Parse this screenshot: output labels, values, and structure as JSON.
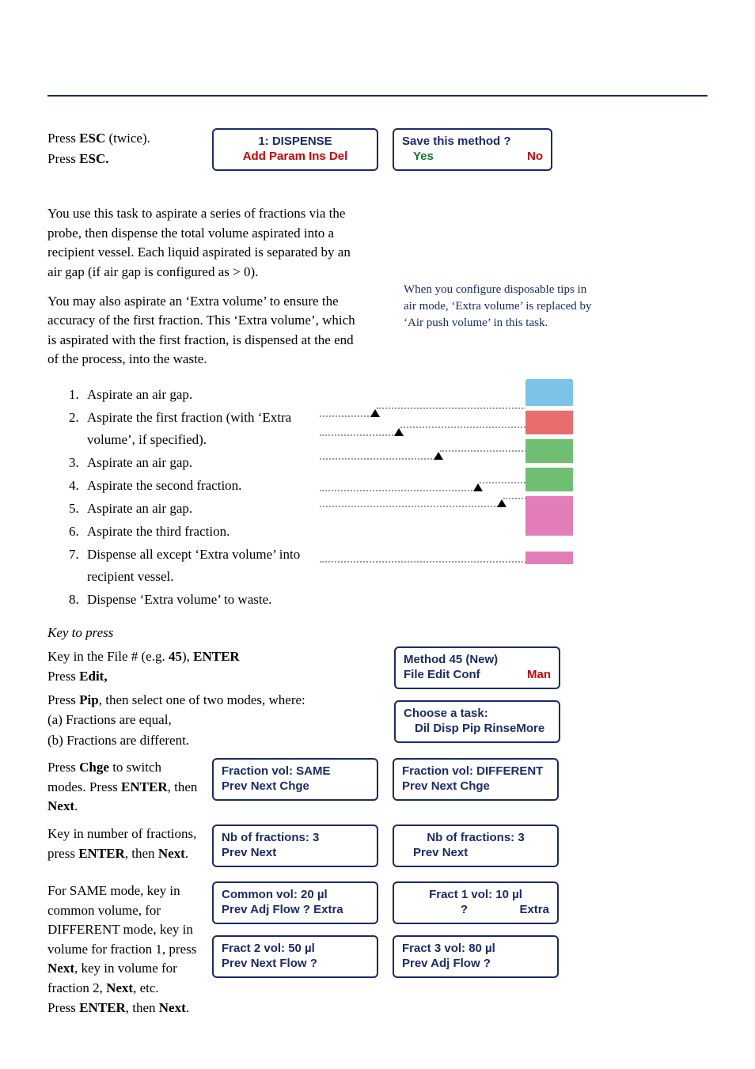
{
  "header": {
    "esc_twice": "Press ESC (twice).",
    "esc_once": "Press ESC.",
    "lcd_dispense_l1": "1: DISPENSE",
    "lcd_dispense_l2": "Add Param Ins  Del",
    "lcd_save_q": "Save this method ?",
    "lcd_save_yes": "Yes",
    "lcd_save_no": "No"
  },
  "intro": {
    "p1": "You use this task to aspirate a series of fractions via the probe, then dispense the total volume aspirated into a recipient vessel. Each liquid aspirated is separated by an air gap (if air gap is configured as > 0).",
    "p2": "You may also aspirate an ‘Extra volume’ to ensure the accuracy of the first fraction. This ‘Extra volume’, which is aspirated with the first fraction, is dispensed at the end of the process, into the waste.",
    "aside": "When you configure disposable tips in air mode, ‘Extra volume’ is replaced by ‘Air push volume’ in this task."
  },
  "steps": {
    "s1": "Aspirate an air gap.",
    "s2": "Aspirate the first fraction (with ‘Extra volume’, if specified).",
    "s3": "Aspirate an air gap.",
    "s4": "Aspirate the second fraction.",
    "s5": "Aspirate an air gap.",
    "s6": "Aspirate the third fraction.",
    "s7": "Dispense all except ‘Extra volume’ into recipient vessel.",
    "s8": "Dispense ‘Extra volume’ to waste."
  },
  "keys": {
    "heading": "Key to press",
    "file_enter": "Key in the File # (e.g. 45), ENTER",
    "press_edit": "Press Edit,",
    "press_pip": "Press Pip, then select one of two modes, where:",
    "mode_a": "(a) Fractions are equal,",
    "mode_b": "(b) Fractions are different.",
    "chge": "Press Chge to switch modes. Press ENTER, then Next.",
    "nfrac": "Key in number of fractions,",
    "enter_next": "press ENTER, then Next.",
    "same_diff": "For SAME mode, key in common volume, for DIFFERENT mode, key in volume for fraction 1, press Next, key in volume for fraction 2, Next, etc.",
    "final": "Press ENTER, then Next."
  },
  "lcds": {
    "method_l1": "Method  45  (New)",
    "method_l2_left": "File Edit Conf",
    "method_l2_right": "Man",
    "task_l1": "Choose a task:",
    "task_l2": "Dil Disp Pip RinseMore",
    "fv_same_l1": "Fraction vol:  SAME",
    "fv_same_l2": "Prev Next       Chge",
    "fv_diff_l1": "Fraction vol:  DIFFERENT",
    "fv_diff_l2": "Prev Next       Chge",
    "nfrac_l1": "Nb of fractions:   3",
    "nfrac_l2": "Prev Next",
    "common_l1": "Common vol:   20   µl",
    "common_l2": "Prev Adj  Flow  ?   Extra",
    "f1_l1": "Fract 1 vol:   10   µl",
    "f1_l2_q": "?",
    "f1_l2_extra": "Extra",
    "f2_l1": "Fract 2 vol:   50   µl",
    "f2_l2": "Prev Next Flow   ?",
    "f3_l1": "Fract 3 vol:   80   µl",
    "f3_l2": "Prev  Adj  Flow   ?"
  }
}
